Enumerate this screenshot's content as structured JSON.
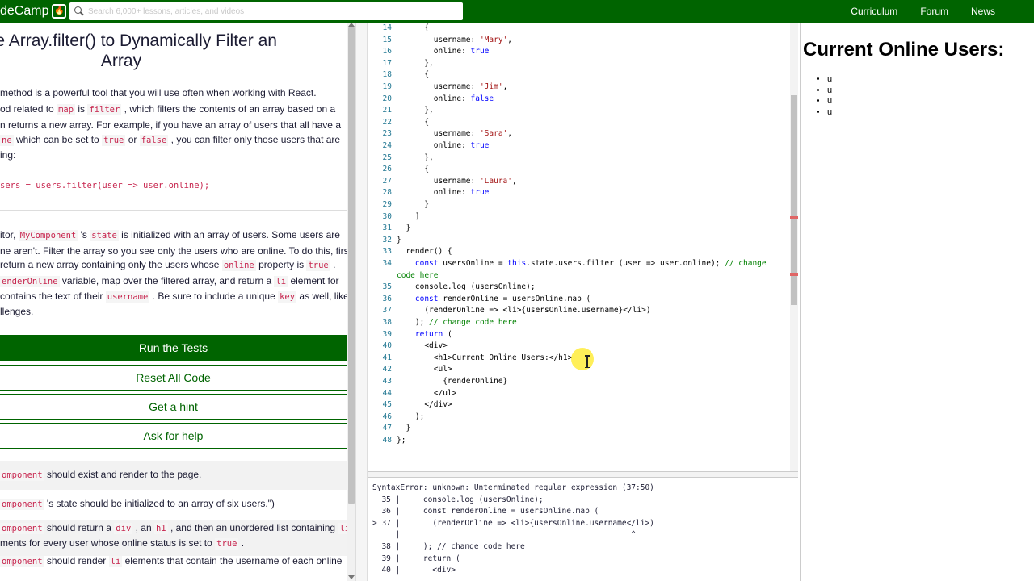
{
  "nav": {
    "brand": "deCamp",
    "brand_icon": "flame-icon",
    "search_placeholder": "Search 6,000+ lessons, articles, and videos",
    "links": [
      "Curriculum",
      "Forum",
      "News"
    ]
  },
  "lesson": {
    "title_line1": ": Use Array.filter() to Dynamically Filter an",
    "title_line2": "Array",
    "intro": [
      [
        "t",
        " method is a powerful tool that you will use often when working with React."
      ],
      [
        "t",
        "od related to ",
        "c",
        "map",
        "t",
        " is ",
        "c",
        "filter",
        "t",
        " , which filters the contents of an array based on a"
      ],
      [
        "t",
        "n returns a new array. For example, if you have an array of users that all have a"
      ],
      [
        "c",
        "ne",
        "t",
        " which can be set to ",
        "c",
        "true",
        "t",
        " or ",
        "c",
        "false",
        "t",
        " , you can filter only those users that are"
      ],
      [
        "t",
        "ing:"
      ]
    ],
    "example_code": "sers = users.filter(user => user.online);",
    "instructions": [
      [
        "t",
        "itor, ",
        "c",
        "MyComponent",
        "t",
        " 's ",
        "c",
        "state",
        "t",
        " is initialized with an array of users. Some users are"
      ],
      [
        "t",
        "ne aren't. Filter the array so you see only the users who are online. To do this, first"
      ],
      [
        "t",
        " return a new array containing only the users whose ",
        "c",
        "online",
        "t",
        " property is ",
        "c",
        "true",
        "t",
        " ."
      ],
      [
        "c",
        "enderOnline",
        "t",
        " variable, map over the filtered array, and return a ",
        "c",
        "li",
        "t",
        " element for"
      ],
      [
        "t",
        " contains the text of their ",
        "c",
        "username",
        "t",
        " . Be sure to include a unique ",
        "c",
        "key",
        "t",
        " as well, like"
      ],
      [
        "t",
        "llenges."
      ]
    ],
    "buttons": {
      "run": "Run the Tests",
      "reset": "Reset All Code",
      "hint": "Get a hint",
      "help": "Ask for help"
    },
    "tests": [
      [
        "c",
        "omponent",
        "t",
        " should exist and render to the page."
      ],
      [
        "c",
        "omponent",
        "t",
        " 's state should be initialized to an array of six users.\")"
      ],
      [
        "c",
        "omponent",
        "t",
        " should return a ",
        "c",
        "div",
        "t",
        " , an ",
        "c",
        "h1",
        "t",
        " , and then an unordered list containing ",
        "c",
        "li"
      ],
      [
        "t",
        "ments for every user whose online status is set to ",
        "c",
        "true",
        "t",
        " ."
      ],
      [
        "c",
        "omponent",
        "t",
        " should render ",
        "c",
        "li",
        "t",
        " elements that contain the username of each online"
      ]
    ]
  },
  "editor": {
    "lines": [
      {
        "n": "14",
        "text": "      {"
      },
      {
        "n": "15",
        "text": "        username: 'Mary',"
      },
      {
        "n": "16",
        "text": "        online: true"
      },
      {
        "n": "17",
        "text": "      },"
      },
      {
        "n": "18",
        "text": "      {"
      },
      {
        "n": "19",
        "text": "        username: 'Jim',"
      },
      {
        "n": "20",
        "text": "        online: false"
      },
      {
        "n": "21",
        "text": "      },"
      },
      {
        "n": "22",
        "text": "      {"
      },
      {
        "n": "23",
        "text": "        username: 'Sara',"
      },
      {
        "n": "24",
        "text": "        online: true"
      },
      {
        "n": "25",
        "text": "      },"
      },
      {
        "n": "26",
        "text": "      {"
      },
      {
        "n": "27",
        "text": "        username: 'Laura',"
      },
      {
        "n": "28",
        "text": "        online: true"
      },
      {
        "n": "29",
        "text": "      }"
      },
      {
        "n": "30",
        "text": "    ]"
      },
      {
        "n": "31",
        "text": "  }"
      },
      {
        "n": "32",
        "text": "}"
      },
      {
        "n": "33",
        "text": "  render() {"
      },
      {
        "n": "34",
        "text": "    const usersOnline = this.state.users.filter (user => user.online); // change"
      },
      {
        "n": "",
        "text": "code here"
      },
      {
        "n": "35",
        "text": "    console.log (usersOnline);"
      },
      {
        "n": "36",
        "text": "    const renderOnline = usersOnline.map ("
      },
      {
        "n": "37",
        "text": "      (renderOnline => <li>{usersOnline.username}</li>)"
      },
      {
        "n": "38",
        "text": "    ); // change code here"
      },
      {
        "n": "39",
        "text": "    return ("
      },
      {
        "n": "40",
        "text": "      <div>"
      },
      {
        "n": "41",
        "text": "        <h1>Current Online Users:</h1>"
      },
      {
        "n": "42",
        "text": "        <ul>"
      },
      {
        "n": "43",
        "text": "          {renderOnline}"
      },
      {
        "n": "44",
        "text": "        </ul>"
      },
      {
        "n": "45",
        "text": "      </div>"
      },
      {
        "n": "46",
        "text": "    );"
      },
      {
        "n": "47",
        "text": "  }"
      },
      {
        "n": "48",
        "text": "};"
      }
    ]
  },
  "console": {
    "lines": [
      "SyntaxError: unknown: Unterminated regular expression (37:50)",
      "  35 |     console.log (usersOnline);",
      "  36 |     const renderOnline = usersOnline.map (",
      "> 37 |       (renderOnline => <li>{usersOnline.username</li>)",
      "     |                                                  ^",
      "  38 |     ); // change code here",
      "  39 |     return (",
      "  40 |       <div>"
    ]
  },
  "preview": {
    "heading": "Current Online Users:",
    "items": [
      "u",
      "u",
      "u",
      "u"
    ]
  }
}
